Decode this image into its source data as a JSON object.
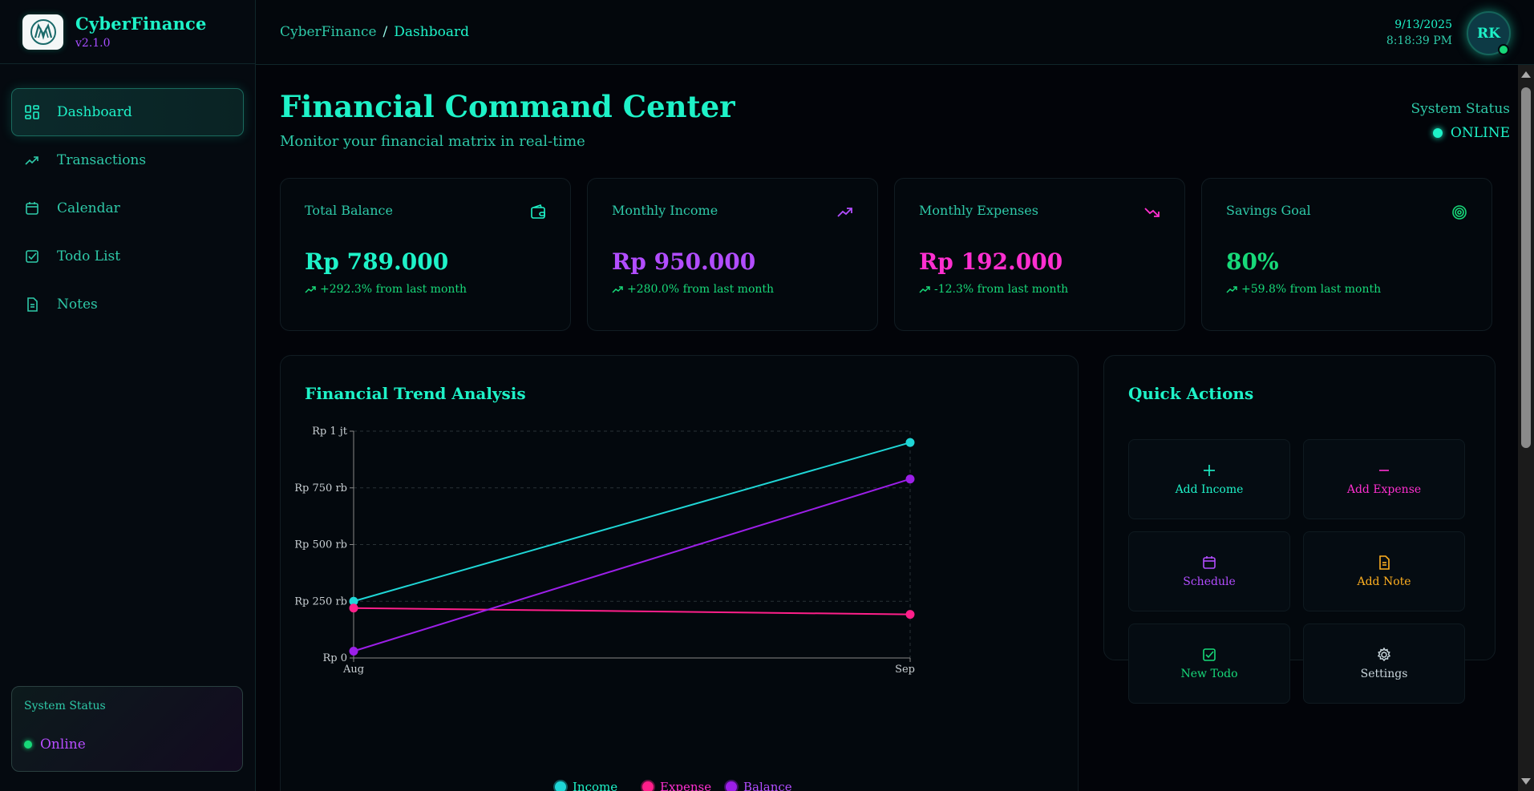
{
  "brand": {
    "title": "CyberFinance",
    "version": "v2.1.0"
  },
  "sidebar": {
    "items": [
      {
        "label": "Dashboard",
        "icon": "dashboard-icon",
        "active": true
      },
      {
        "label": "Transactions",
        "icon": "trending-up-icon"
      },
      {
        "label": "Calendar",
        "icon": "calendar-icon"
      },
      {
        "label": "Todo List",
        "icon": "checkbox-icon"
      },
      {
        "label": "Notes",
        "icon": "note-icon"
      }
    ],
    "status": {
      "title": "System Status",
      "value": "Online"
    }
  },
  "topbar": {
    "breadcrumb": {
      "root": "CyberFinance",
      "sep": "/",
      "current": "Dashboard"
    },
    "date": "9/13/2025",
    "time": "8:18:39 PM",
    "avatar": "RK"
  },
  "header": {
    "title": "Financial Command Center",
    "subtitle": "Monitor your financial matrix in real-time",
    "status_label": "System Status",
    "status_value": "ONLINE"
  },
  "cards": [
    {
      "title": "Total Balance",
      "value": "Rp 789.000",
      "delta": "+292.3% from last month",
      "color": "#1ef2c8",
      "icon": "wallet-icon"
    },
    {
      "title": "Monthly Income",
      "value": "Rp 950.000",
      "delta": "+280.0% from last month",
      "color": "#b24dff",
      "icon": "trending-up-icon"
    },
    {
      "title": "Monthly Expenses",
      "value": "Rp 192.000",
      "delta": "-12.3% from last month",
      "color": "#ff2fd0",
      "icon": "trending-down-icon"
    },
    {
      "title": "Savings Goal",
      "value": "80%",
      "delta": "+59.8% from last month",
      "color": "#17d979",
      "icon": "target-icon"
    }
  ],
  "chart_panel": {
    "title": "Financial Trend Analysis"
  },
  "chart_data": {
    "type": "line",
    "title": "Financial Trend Analysis",
    "x": [
      "Aug",
      "Sep"
    ],
    "ytick_labels": [
      "Rp 0",
      "Rp 250 rb",
      "Rp 500 rb",
      "Rp 750 rb",
      "Rp 1 jt"
    ],
    "ylim": [
      0,
      1000000
    ],
    "grid": true,
    "legend_position": "bottom",
    "series": [
      {
        "name": "Income",
        "values": [
          250000,
          950000
        ],
        "color": "#1fd6d6"
      },
      {
        "name": "Expense",
        "values": [
          220000,
          192000
        ],
        "color": "#ff1f8a"
      },
      {
        "name": "Balance",
        "values": [
          30000,
          789000
        ],
        "color": "#9c1fe8"
      }
    ]
  },
  "quick_actions": {
    "title": "Quick Actions",
    "buttons": [
      {
        "label": "Add Income",
        "icon": "plus-icon",
        "color": "#1ef2c8"
      },
      {
        "label": "Add Expense",
        "icon": "minus-icon",
        "color": "#ff2fd0"
      },
      {
        "label": "Schedule",
        "icon": "calendar-icon",
        "color": "#b24dff"
      },
      {
        "label": "Add Note",
        "icon": "note-icon",
        "color": "#ffb020"
      },
      {
        "label": "New Todo",
        "icon": "checkbox-icon",
        "color": "#17d979"
      },
      {
        "label": "Settings",
        "icon": "gear-icon",
        "color": "#c9d6dc"
      }
    ]
  }
}
